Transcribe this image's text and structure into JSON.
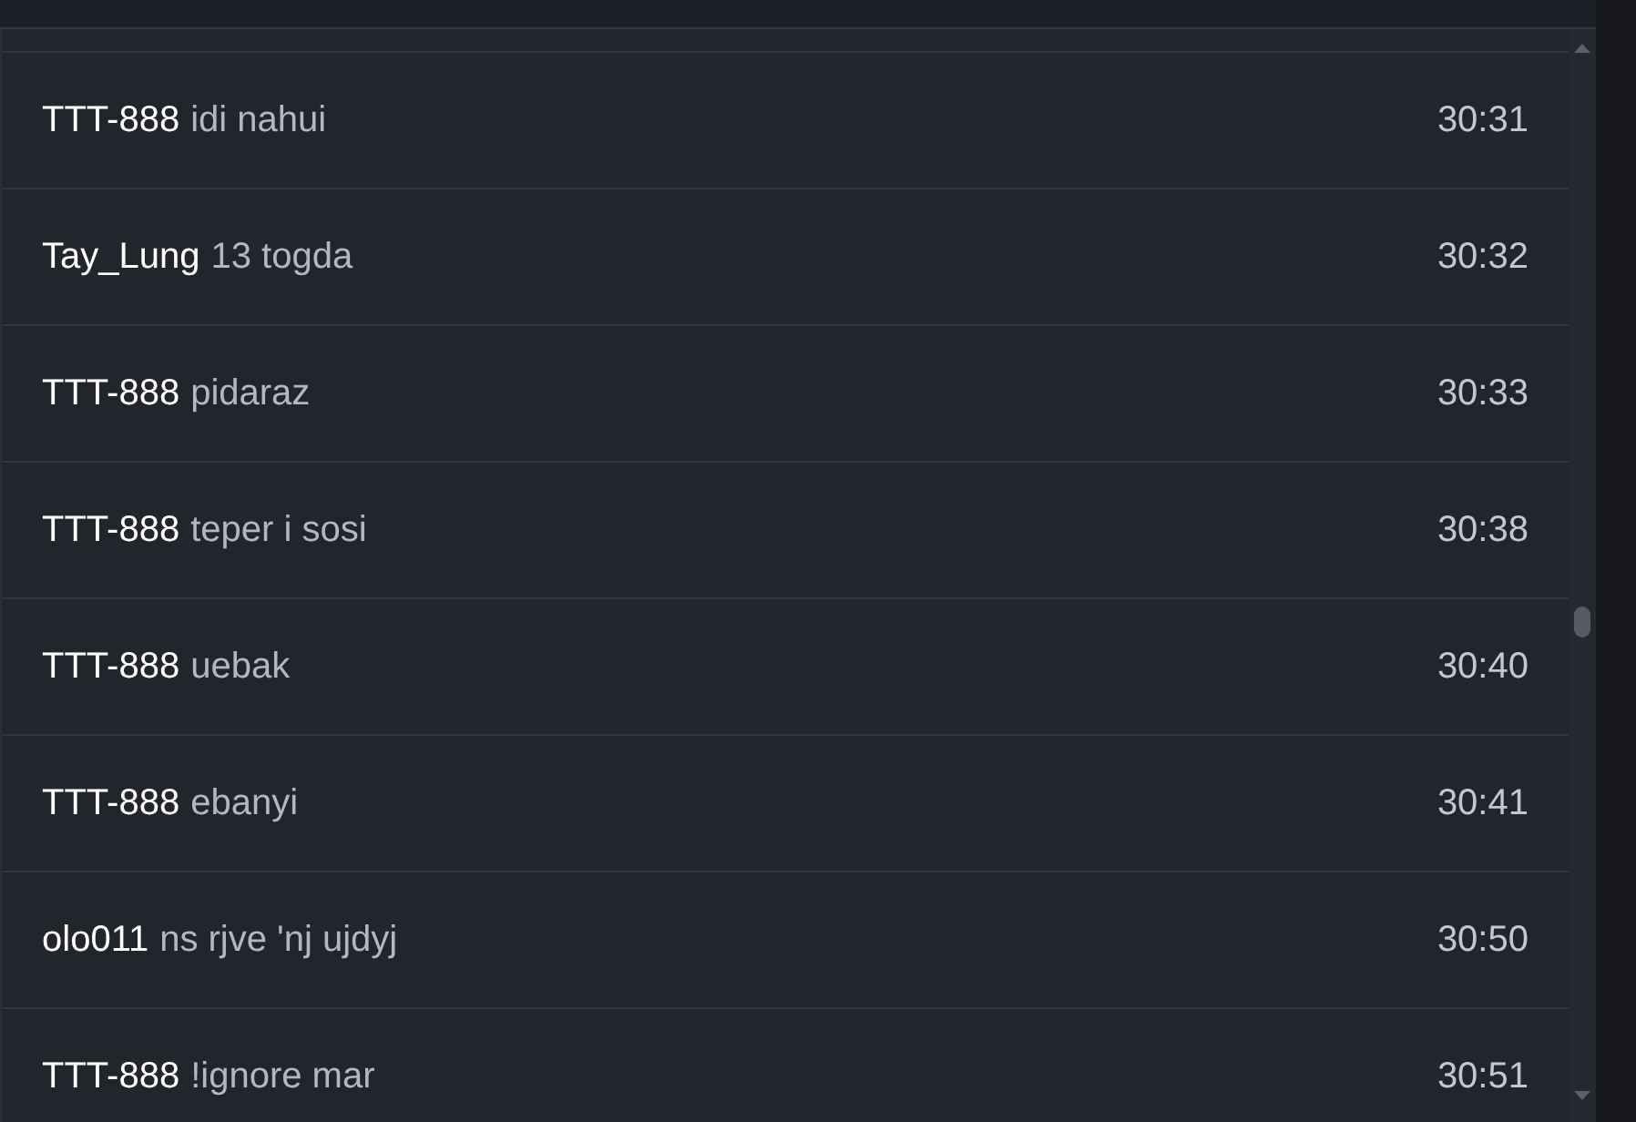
{
  "messages": [
    {
      "user": "TTT-888",
      "text": "idi nahui",
      "time": "30:31"
    },
    {
      "user": "Tay_Lung",
      "text": "13 togda",
      "time": "30:32"
    },
    {
      "user": "TTT-888",
      "text": "pidaraz",
      "time": "30:33"
    },
    {
      "user": "TTT-888",
      "text": "teper i sosi",
      "time": "30:38"
    },
    {
      "user": "TTT-888",
      "text": "uebak",
      "time": "30:40"
    },
    {
      "user": "TTT-888",
      "text": "ebanyi",
      "time": "30:41"
    },
    {
      "user": "olo011",
      "text": "ns rjve 'nj ujdyj",
      "time": "30:50"
    },
    {
      "user": "TTT-888",
      "text": "!ignore mar",
      "time": "30:51"
    }
  ]
}
